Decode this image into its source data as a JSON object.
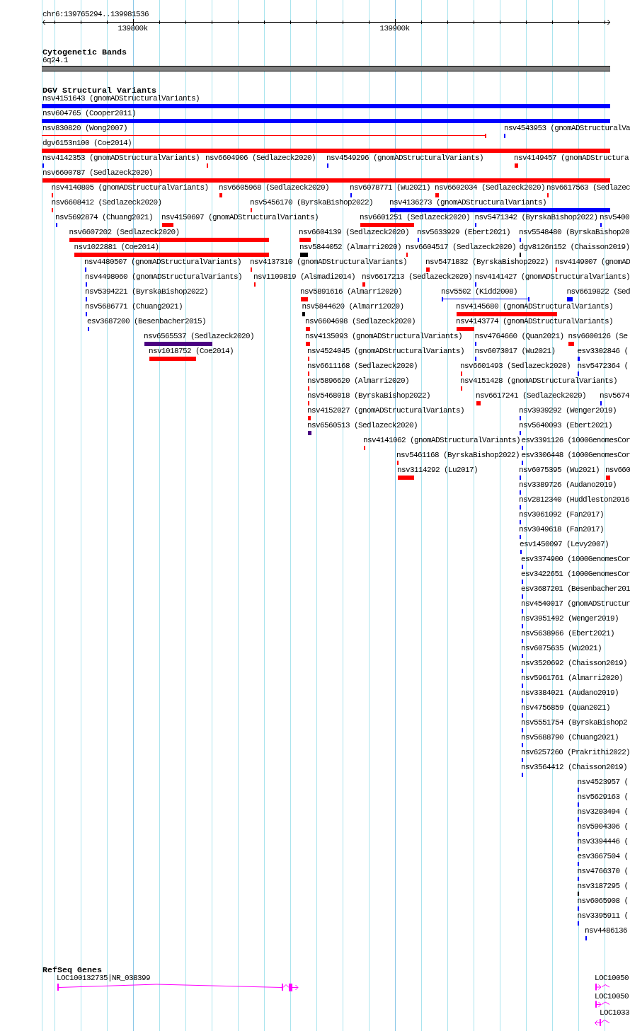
{
  "ruler": {
    "region": "chr6:139765294..139981536",
    "ticks": [
      "139800k",
      "139900k"
    ]
  },
  "tracks": [
    {
      "kind": "bands",
      "title": "Cytogenetic Bands",
      "features": [
        {
          "label": "6q24.1"
        }
      ]
    },
    {
      "kind": "variants",
      "title": "DGV Structural Variants",
      "features": [
        {
          "label": "nsv4151643 (gnomADStructuralVariants)",
          "color": "#0000ff",
          "kind": "bar"
        },
        {
          "label": "nsv604765 (Cooper2011)",
          "color": "#0000ff",
          "kind": "bar"
        },
        {
          "label": "nsv830820 (Wong2007)",
          "color": "#ff0000",
          "kind": "span"
        },
        {
          "label": "nsv4543953 (gnomADStructuralVa",
          "color": "#0000ff",
          "kind": "bar"
        },
        {
          "label": "dgv6153n100 (Coe2014)",
          "color": "#ff0000",
          "kind": "bar"
        },
        {
          "label": "nsv4142353 (gnomADStructuralVariants)",
          "color": "#0000ff",
          "kind": "bar"
        },
        {
          "label": "nsv6604906 (Sedlazeck2020)",
          "color": "#ff0000",
          "kind": "bar"
        },
        {
          "label": "nsv4549296 (gnomADStructuralVariants)",
          "color": "#0000ff",
          "kind": "bar"
        },
        {
          "label": "nsv4149457 (gnomADStructura",
          "color": "#ff0000",
          "kind": "bar"
        },
        {
          "label": "nsv6600787 (Sedlazeck2020)",
          "color": "#ff0000",
          "kind": "bar"
        },
        {
          "label": "nsv4140805 (gnomADStructuralVariants)",
          "color": "#ff0000",
          "kind": "bar"
        },
        {
          "label": "nsv6605968 (Sedlazeck2020)",
          "color": "#ff0000",
          "kind": "bar"
        },
        {
          "label": "nsv6078771 (Wu2021)",
          "color": "#0000ff",
          "kind": "bar"
        },
        {
          "label": "nsv6602034 (Sedlazeck2020)",
          "color": "#ff0000",
          "kind": "bar"
        },
        {
          "label": "nsv6617563 (Sedlazec",
          "color": "#ff0000",
          "kind": "bar"
        },
        {
          "label": "nsv6608412 (Sedlazeck2020)",
          "color": "#ff0000",
          "kind": "bar"
        },
        {
          "label": "nsv5456170 (ByrskaBishop2022)",
          "color": "#ff0000",
          "kind": "bar"
        },
        {
          "label": "nsv4136273 (gnomADStructuralVariants)",
          "color": "#0000ff",
          "kind": "bar"
        },
        {
          "label": "nsv5692874 (Chuang2021)",
          "color": "#0000ff",
          "kind": "bar"
        },
        {
          "label": "nsv4150697 (gnomADStructuralVariants)",
          "color": "#ff0000",
          "kind": "bar"
        },
        {
          "label": "nsv6601251 (Sedlazeck2020)",
          "color": "#ff0000",
          "kind": "bar"
        },
        {
          "label": "nsv5471342 (ByrskaBishop2022)",
          "color": "#0000ff",
          "kind": "bar"
        },
        {
          "label": "nsv5400",
          "color": "#0000ff",
          "kind": "bar"
        },
        {
          "label": "nsv6607202 (Sedlazeck2020)",
          "color": "#ff0000",
          "kind": "bar"
        },
        {
          "label": "nsv6604139 (Sedlazeck2020)",
          "color": "#ff0000",
          "kind": "bar"
        },
        {
          "label": "nsv5633929 (Ebert2021)",
          "color": "#0000ff",
          "kind": "bar"
        },
        {
          "label": "nsv5548480 (ByrskaBishop20",
          "color": "#0000ff",
          "kind": "bar"
        },
        {
          "label": "nsv1022881 (Coe2014)",
          "color": "#ff0000",
          "kind": "bar"
        },
        {
          "label": "nsv5844052 (Almarri2020)",
          "color": "#000000",
          "kind": "bar"
        },
        {
          "label": "nsv6604517 (Sedlazeck2020)",
          "color": "#ff0000",
          "kind": "bar"
        },
        {
          "label": "dgv8126n152 (Chaisson2019)",
          "color": "#000000",
          "kind": "bar"
        },
        {
          "label": "nsv4480507 (gnomADStructuralVariants)",
          "color": "#0000ff",
          "kind": "bar"
        },
        {
          "label": "nsv4137310 (gnomADStructuralVariants)",
          "color": "#ff0000",
          "kind": "bar"
        },
        {
          "label": "nsv5471832 (ByrskaBishop2022)",
          "color": "#ff0000",
          "kind": "bar"
        },
        {
          "label": "nsv4149007 (gnomAD",
          "color": "#ff0000",
          "kind": "bar"
        },
        {
          "label": "nsv4498060 (gnomADStructuralVariants)",
          "color": "#0000ff",
          "kind": "bar"
        },
        {
          "label": "nsv1109819 (Alsmadi2014)",
          "color": "#ff0000",
          "kind": "bar"
        },
        {
          "label": "nsv6617213 (Sedlazeck2020)",
          "color": "#ff0000",
          "kind": "bar"
        },
        {
          "label": "nsv4141427 (gnomADStructuralVariants)",
          "color": "#0000ff",
          "kind": "bar"
        },
        {
          "label": "nsv5394221 (ByrskaBishop2022)",
          "color": "#0000ff",
          "kind": "bar"
        },
        {
          "label": "nsv5891616 (Almarri2020)",
          "color": "#ff0000",
          "kind": "bar"
        },
        {
          "label": "nsv5502 (Kidd2008)",
          "color": "#0000ff",
          "kind": "span"
        },
        {
          "label": "nsv6619822 (Sed",
          "color": "#0000ff",
          "kind": "bar"
        },
        {
          "label": "nsv5686771 (Chuang2021)",
          "color": "#0000ff",
          "kind": "bar"
        },
        {
          "label": "nsv5844620 (Almarri2020)",
          "color": "#000000",
          "kind": "bar"
        },
        {
          "label": "nsv4145680 (gnomADStructuralVariants)",
          "color": "#ff0000",
          "kind": "bar"
        },
        {
          "label": "esv3687200 (Besenbacher2015)",
          "color": "#0000ff",
          "kind": "bar"
        },
        {
          "label": "nsv6604698 (Sedlazeck2020)",
          "color": "#ff0000",
          "kind": "bar"
        },
        {
          "label": "nsv4143774 (gnomADStructuralVariants)",
          "color": "#ff0000",
          "kind": "bar"
        },
        {
          "label": "nsv6565537 (Sedlazeck2020)",
          "color": "#4b0082",
          "kind": "bar"
        },
        {
          "label": "nsv4135093 (gnomADStructuralVariants)",
          "color": "#ff0000",
          "kind": "bar"
        },
        {
          "label": "nsv4764660 (Quan2021)",
          "color": "#0000ff",
          "kind": "bar"
        },
        {
          "label": "nsv6600126 (Se",
          "color": "#ff0000",
          "kind": "bar"
        },
        {
          "label": "nsv1018752 (Coe2014)",
          "color": "#ff0000",
          "kind": "bar"
        },
        {
          "label": "nsv4524045 (gnomADStructuralVariants)",
          "color": "#ff0000",
          "kind": "bar"
        },
        {
          "label": "nsv6073017 (Wu2021)",
          "color": "#0000ff",
          "kind": "bar"
        },
        {
          "label": "esv3302846 (",
          "color": "#0000ff",
          "kind": "bar"
        },
        {
          "label": "nsv6611168 (Sedlazeck2020)",
          "color": "#ff0000",
          "kind": "bar"
        },
        {
          "label": "nsv6601493 (Sedlazeck2020)",
          "color": "#ff0000",
          "kind": "bar"
        },
        {
          "label": "nsv5472364 (",
          "color": "#0000ff",
          "kind": "bar"
        },
        {
          "label": "nsv5896620 (Almarri2020)",
          "color": "#ff0000",
          "kind": "bar"
        },
        {
          "label": "nsv4151428 (gnomADStructuralVariants)",
          "color": "#ff0000",
          "kind": "bar"
        },
        {
          "label": "nsv5468018 (ByrskaBishop2022)",
          "color": "#ff0000",
          "kind": "bar"
        },
        {
          "label": "nsv6617241 (Sedlazeck2020)",
          "color": "#ff0000",
          "kind": "bar"
        },
        {
          "label": "nsv5674",
          "color": "#0000ff",
          "kind": "bar"
        },
        {
          "label": "nsv4152027 (gnomADStructuralVariants)",
          "color": "#ff0000",
          "kind": "bar"
        },
        {
          "label": "nsv3939292 (Wenger2019)",
          "color": "#0000ff",
          "kind": "bar"
        },
        {
          "label": "nsv6560513 (Sedlazeck2020)",
          "color": "#4b0082",
          "kind": "bar"
        },
        {
          "label": "nsv5640093 (Ebert2021)",
          "color": "#0000ff",
          "kind": "bar"
        },
        {
          "label": "nsv4141062 (gnomADStructuralVariants)",
          "color": "#ff0000",
          "kind": "bar"
        },
        {
          "label": "esv3391126 (1000GenomesCor",
          "color": "#0000ff",
          "kind": "bar"
        },
        {
          "label": "nsv5461168 (ByrskaBishop2022)",
          "color": "#ff0000",
          "kind": "bar"
        },
        {
          "label": "esv3306448 (1000GenomesCor",
          "color": "#0000ff",
          "kind": "bar"
        },
        {
          "label": "nsv3114292 (Lu2017)",
          "color": "#ff0000",
          "kind": "bar"
        },
        {
          "label": "nsv6075395 (Wu2021)",
          "color": "#0000ff",
          "kind": "bar"
        },
        {
          "label": "nsv660",
          "color": "#ff0000",
          "kind": "bar"
        },
        {
          "label": "nsv3389726 (Audano2019)",
          "color": "#0000ff",
          "kind": "bar"
        },
        {
          "label": "nsv2812340 (Huddleston2016",
          "color": "#0000ff",
          "kind": "bar"
        },
        {
          "label": "nsv3061092 (Fan2017)",
          "color": "#0000ff",
          "kind": "bar"
        },
        {
          "label": "nsv3049618 (Fan2017)",
          "color": "#0000ff",
          "kind": "bar"
        },
        {
          "label": "esv1450097 (Levy2007)",
          "color": "#0000ff",
          "kind": "bar"
        },
        {
          "label": "esv3374900 (1000GenomesCor",
          "color": "#0000ff",
          "kind": "bar"
        },
        {
          "label": "esv3422651 (1000GenomesCor",
          "color": "#0000ff",
          "kind": "bar"
        },
        {
          "label": "esv3687201 (Besenbacher201",
          "color": "#0000ff",
          "kind": "bar"
        },
        {
          "label": "nsv4540017 (gnomADStructur",
          "color": "#0000ff",
          "kind": "bar"
        },
        {
          "label": "nsv3951492 (Wenger2019)",
          "color": "#0000ff",
          "kind": "bar"
        },
        {
          "label": "nsv5638966 (Ebert2021)",
          "color": "#0000ff",
          "kind": "bar"
        },
        {
          "label": "nsv6075635 (Wu2021)",
          "color": "#0000ff",
          "kind": "bar"
        },
        {
          "label": "nsv3520692 (Chaisson2019)",
          "color": "#0000ff",
          "kind": "bar"
        },
        {
          "label": "nsv5961761 (Almarri2020)",
          "color": "#0000ff",
          "kind": "bar"
        },
        {
          "label": "nsv3384021 (Audano2019)",
          "color": "#0000ff",
          "kind": "bar"
        },
        {
          "label": "nsv4756859 (Quan2021)",
          "color": "#0000ff",
          "kind": "bar"
        },
        {
          "label": "nsv5551754 (ByrskaBishop2",
          "color": "#0000ff",
          "kind": "bar"
        },
        {
          "label": "nsv5688790 (Chuang2021)",
          "color": "#0000ff",
          "kind": "bar"
        },
        {
          "label": "nsv6257260 (Prakrithi2022)",
          "color": "#0000ff",
          "kind": "bar"
        },
        {
          "label": "nsv3564412 (Chaisson2019)",
          "color": "#0000ff",
          "kind": "bar"
        },
        {
          "label": "nsv4523957 (",
          "color": "#0000ff",
          "kind": "bar"
        },
        {
          "label": "nsv5629163 (",
          "color": "#0000ff",
          "kind": "bar"
        },
        {
          "label": "nsv3203494 (",
          "color": "#0000ff",
          "kind": "bar"
        },
        {
          "label": "nsv5904306 (",
          "color": "#0000ff",
          "kind": "bar"
        },
        {
          "label": "nsv3394446 (",
          "color": "#0000ff",
          "kind": "bar"
        },
        {
          "label": "esv3667504 (",
          "color": "#0000ff",
          "kind": "bar"
        },
        {
          "label": "nsv4766370 (",
          "color": "#0000ff",
          "kind": "bar"
        },
        {
          "label": "nsv3187295 (",
          "color": "#000000",
          "kind": "bar"
        },
        {
          "label": "nsv6065908 (",
          "color": "#0000ff",
          "kind": "bar"
        },
        {
          "label": "nsv3395911 (",
          "color": "#0000ff",
          "kind": "bar"
        },
        {
          "label": "nsv4486136",
          "color": "#0000ff",
          "kind": "bar"
        }
      ]
    },
    {
      "kind": "genes",
      "title": "RefSeq Genes",
      "features": [
        {
          "label": "LOC100132735|NR_038399",
          "reverse": false
        },
        {
          "label": "LOC10050",
          "reverse": false
        },
        {
          "label": "LOC10050",
          "reverse": false
        },
        {
          "label": "LOC1033",
          "reverse": true
        }
      ]
    }
  ]
}
